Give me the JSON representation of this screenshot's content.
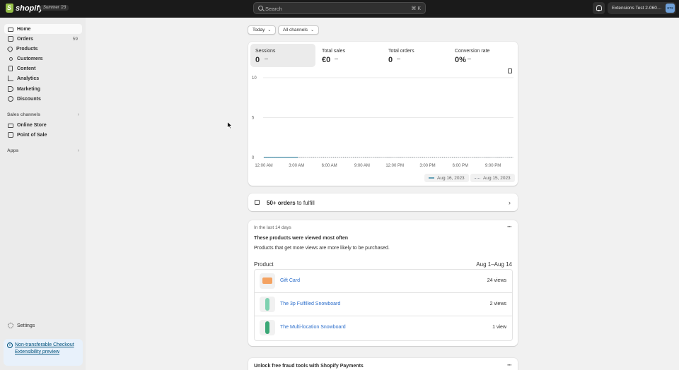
{
  "topbar": {
    "logo_text": "shopify",
    "edition": "Summer '23",
    "search_placeholder": "Search",
    "search_shortcut": "⌘ K",
    "store_name": "Extensions Test 2-060…",
    "avatar_initials": "ET2"
  },
  "sidebar": {
    "items": [
      {
        "label": "Home",
        "icon": "home-icon",
        "active": true
      },
      {
        "label": "Orders",
        "icon": "orders-icon",
        "count": "59"
      },
      {
        "label": "Products",
        "icon": "tag-icon"
      },
      {
        "label": "Customers",
        "icon": "person-icon"
      },
      {
        "label": "Content",
        "icon": "document-icon"
      },
      {
        "label": "Analytics",
        "icon": "chart-icon"
      },
      {
        "label": "Marketing",
        "icon": "megaphone-icon"
      },
      {
        "label": "Discounts",
        "icon": "discount-icon"
      }
    ],
    "sales_channels_label": "Sales channels",
    "channels": [
      {
        "label": "Online Store",
        "icon": "store-icon"
      },
      {
        "label": "Point of Sale",
        "icon": "pos-icon"
      }
    ],
    "apps_label": "Apps",
    "settings_label": "Settings",
    "notice_text": "Non-transferable Checkout Extensibility preview"
  },
  "filters": {
    "date": "Today",
    "channels": "All channels"
  },
  "metrics": [
    {
      "label": "Sessions",
      "value": "0",
      "selected": true
    },
    {
      "label": "Total sales",
      "value": "€0"
    },
    {
      "label": "Total orders",
      "value": "0"
    },
    {
      "label": "Conversion rate",
      "value": "0%"
    }
  ],
  "chart_data": {
    "type": "line",
    "x": [
      "12:00 AM",
      "3:00 AM",
      "6:00 AM",
      "9:00 AM",
      "12:00 PM",
      "3:00 PM",
      "6:00 PM",
      "9:00 PM"
    ],
    "y_ticks": [
      "10",
      "5",
      "0"
    ],
    "ylim": [
      0,
      10
    ],
    "series": [
      {
        "name": "Aug 16, 2023",
        "values": [
          0,
          0,
          0,
          0,
          0,
          0,
          0,
          0
        ],
        "style": "solid",
        "color": "#65a0b6"
      },
      {
        "name": "Aug 15, 2023",
        "values": [
          0,
          0,
          0,
          0,
          0,
          0,
          0,
          0
        ],
        "style": "dotted",
        "color": "#9aa0a6"
      }
    ],
    "grid": true,
    "legend": "bottom-right"
  },
  "fulfill": {
    "bold": "50+ orders",
    "rest": " to fulfill"
  },
  "products_card": {
    "period": "In the last 14 days",
    "title": "These products were viewed most often",
    "subtitle": "Products that get more views are more likely to be purchased.",
    "col_product": "Product",
    "col_range": "Aug 1–Aug 14",
    "rows": [
      {
        "name": "Gift Card",
        "views": "24 views",
        "thumb_color": "#f4a261"
      },
      {
        "name": "The 3p Fulfilled Snowboard",
        "views": "2 views",
        "thumb_color": "#7fd1b0"
      },
      {
        "name": "The Multi-location Snowboard",
        "views": "1 view",
        "thumb_color": "#3aa776"
      }
    ]
  },
  "bottom_card": {
    "title": "Unlock free fraud tools with Shopify Payments"
  }
}
